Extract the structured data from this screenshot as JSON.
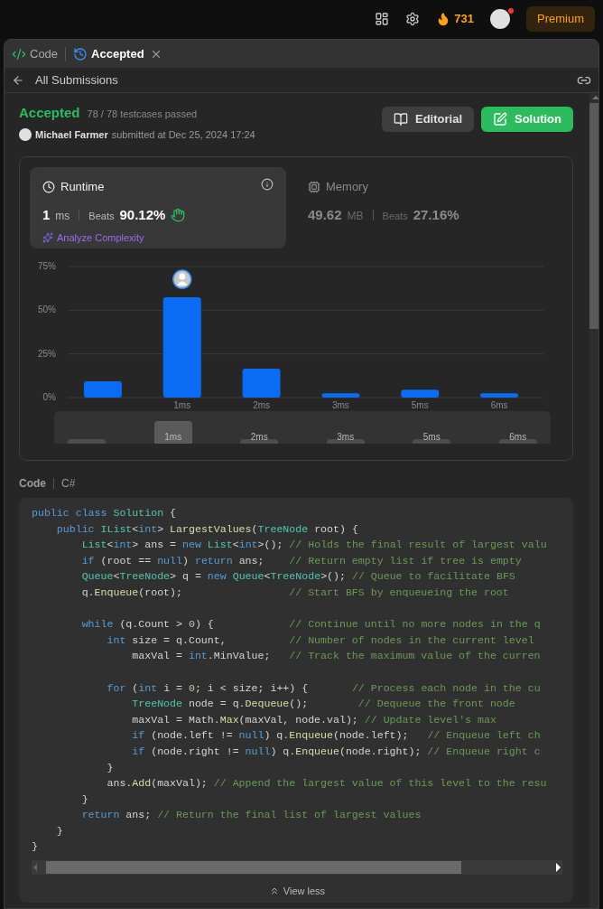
{
  "top_bar": {
    "streak": "731",
    "premium": "Premium",
    "notification_dot": true
  },
  "tabs": [
    {
      "label": "Code",
      "kind": "code",
      "selected": false,
      "closable": false
    },
    {
      "label": "Accepted",
      "kind": "history",
      "selected": true,
      "closable": true
    }
  ],
  "back_link": "All Submissions",
  "result": {
    "status": "Accepted",
    "testcases": "78 / 78 testcases passed",
    "author": "Michael Farmer",
    "submitted": "submitted at Dec 25, 2024 17:24"
  },
  "buttons": [
    {
      "label": "Editorial",
      "kind": "editorial"
    },
    {
      "label": "Solution",
      "kind": "solution"
    }
  ],
  "metrics": [
    {
      "kind": "runtime",
      "label": "Runtime",
      "value": "1",
      "unit": "ms",
      "beats_label": "Beats",
      "beats": "90.12%",
      "selected": true,
      "link": "Analyze Complexity"
    },
    {
      "kind": "memory",
      "label": "Memory",
      "value": "49.62",
      "unit": "MB",
      "beats_label": "Beats",
      "beats": "27.16%",
      "selected": false
    }
  ],
  "chart_data": {
    "type": "bar",
    "categories": [
      null,
      "1ms",
      "2ms",
      "3ms",
      "5ms",
      "6ms"
    ],
    "ylim": [
      0,
      75
    ],
    "yticks": [
      {
        "value": 0,
        "label": "0%"
      },
      {
        "value": 25,
        "label": "25%"
      },
      {
        "value": 50,
        "label": "50%"
      },
      {
        "value": 75,
        "label": "75%"
      }
    ],
    "series": [
      {
        "color": "#0a6cf5",
        "values": [
          9.3,
          57.4,
          16.5,
          2.5,
          4.5,
          2.5
        ]
      }
    ]
  },
  "overview": [
    {
      "selected": false
    },
    {
      "label": "1ms",
      "selected": true
    },
    {
      "label": "2ms",
      "selected": false
    },
    {
      "label": "3ms",
      "selected": false
    },
    {
      "label": "5ms",
      "selected": false
    },
    {
      "label": "6ms",
      "selected": false
    }
  ],
  "code_section": {
    "title": "Code",
    "language": "C#"
  },
  "code_lines": [
    {
      "kind": "code",
      "tokens": [
        {
          "kind": "k",
          "text": "public class "
        },
        {
          "kind": "t",
          "text": "Solution"
        },
        {
          "kind": "p",
          "text": " {"
        }
      ]
    },
    {
      "kind": "code",
      "tokens": [
        {
          "kind": "k",
          "text": "    public "
        },
        {
          "kind": "t",
          "text": "IList"
        },
        {
          "kind": "p",
          "text": "<"
        },
        {
          "kind": "k",
          "text": "int"
        },
        {
          "kind": "p",
          "text": "> "
        },
        {
          "kind": "f",
          "text": "LargestValues"
        },
        {
          "kind": "p",
          "text": "("
        },
        {
          "kind": "t",
          "text": "TreeNode"
        },
        {
          "kind": "p",
          "text": " root) {"
        }
      ]
    },
    {
      "kind": "code",
      "tokens": [
        {
          "kind": "t",
          "text": "        List"
        },
        {
          "kind": "p",
          "text": "<"
        },
        {
          "kind": "k",
          "text": "int"
        },
        {
          "kind": "p",
          "text": "> ans = "
        },
        {
          "kind": "k",
          "text": "new "
        },
        {
          "kind": "t",
          "text": "List"
        },
        {
          "kind": "p",
          "text": "<"
        },
        {
          "kind": "k",
          "text": "int"
        },
        {
          "kind": "p",
          "text": ">(); "
        },
        {
          "kind": "c",
          "text": "// Holds the final result of largest valu"
        }
      ]
    },
    {
      "kind": "code",
      "tokens": [
        {
          "kind": "k",
          "text": "        if"
        },
        {
          "kind": "p",
          "text": " (root == "
        },
        {
          "kind": "k",
          "text": "null"
        },
        {
          "kind": "p",
          "text": ") "
        },
        {
          "kind": "k",
          "text": "return"
        },
        {
          "kind": "p",
          "text": " ans;    "
        },
        {
          "kind": "c",
          "text": "// Return empty list if tree is empty"
        }
      ]
    },
    {
      "kind": "code",
      "tokens": [
        {
          "kind": "t",
          "text": "        Queue"
        },
        {
          "kind": "p",
          "text": "<"
        },
        {
          "kind": "t",
          "text": "TreeNode"
        },
        {
          "kind": "p",
          "text": "> q = "
        },
        {
          "kind": "k",
          "text": "new "
        },
        {
          "kind": "t",
          "text": "Queue"
        },
        {
          "kind": "p",
          "text": "<"
        },
        {
          "kind": "t",
          "text": "TreeNode"
        },
        {
          "kind": "p",
          "text": ">(); "
        },
        {
          "kind": "c",
          "text": "// Queue to facilitate BFS"
        }
      ]
    },
    {
      "kind": "code",
      "tokens": [
        {
          "kind": "p",
          "text": "        q."
        },
        {
          "kind": "f",
          "text": "Enqueue"
        },
        {
          "kind": "p",
          "text": "(root);                 "
        },
        {
          "kind": "c",
          "text": "// Start BFS by enqueueing the root"
        }
      ]
    },
    {
      "kind": "blank"
    },
    {
      "kind": "code",
      "tokens": [
        {
          "kind": "k",
          "text": "        while"
        },
        {
          "kind": "p",
          "text": " (q.Count > "
        },
        {
          "kind": "n",
          "text": "0"
        },
        {
          "kind": "p",
          "text": ") {            "
        },
        {
          "kind": "c",
          "text": "// Continue until no more nodes in the q"
        }
      ]
    },
    {
      "kind": "code",
      "tokens": [
        {
          "kind": "k",
          "text": "            int"
        },
        {
          "kind": "p",
          "text": " size = q.Count,          "
        },
        {
          "kind": "c",
          "text": "// Number of nodes in the current level"
        }
      ]
    },
    {
      "kind": "code",
      "tokens": [
        {
          "kind": "p",
          "text": "                maxVal = "
        },
        {
          "kind": "k",
          "text": "int"
        },
        {
          "kind": "p",
          "text": ".MinValue;   "
        },
        {
          "kind": "c",
          "text": "// Track the maximum value of the curren"
        }
      ]
    },
    {
      "kind": "blank"
    },
    {
      "kind": "code",
      "tokens": [
        {
          "kind": "k",
          "text": "            for"
        },
        {
          "kind": "p",
          "text": " ("
        },
        {
          "kind": "k",
          "text": "int"
        },
        {
          "kind": "p",
          "text": " i = "
        },
        {
          "kind": "n",
          "text": "0"
        },
        {
          "kind": "p",
          "text": "; i < size; i++) {       "
        },
        {
          "kind": "c",
          "text": "// Process each node in the cu"
        }
      ]
    },
    {
      "kind": "code",
      "tokens": [
        {
          "kind": "t",
          "text": "                TreeNode"
        },
        {
          "kind": "p",
          "text": " node = q."
        },
        {
          "kind": "f",
          "text": "Dequeue"
        },
        {
          "kind": "p",
          "text": "();        "
        },
        {
          "kind": "c",
          "text": "// Dequeue the front node"
        }
      ]
    },
    {
      "kind": "code",
      "tokens": [
        {
          "kind": "p",
          "text": "                maxVal = Math."
        },
        {
          "kind": "f",
          "text": "Max"
        },
        {
          "kind": "p",
          "text": "(maxVal, node.val); "
        },
        {
          "kind": "c",
          "text": "// Update level's max"
        }
      ]
    },
    {
      "kind": "code",
      "tokens": [
        {
          "kind": "k",
          "text": "                if"
        },
        {
          "kind": "p",
          "text": " (node.left != "
        },
        {
          "kind": "k",
          "text": "null"
        },
        {
          "kind": "p",
          "text": ") q."
        },
        {
          "kind": "f",
          "text": "Enqueue"
        },
        {
          "kind": "p",
          "text": "(node.left);   "
        },
        {
          "kind": "c",
          "text": "// Enqueue left ch"
        }
      ]
    },
    {
      "kind": "code",
      "tokens": [
        {
          "kind": "k",
          "text": "                if"
        },
        {
          "kind": "p",
          "text": " (node.right != "
        },
        {
          "kind": "k",
          "text": "null"
        },
        {
          "kind": "p",
          "text": ") q."
        },
        {
          "kind": "f",
          "text": "Enqueue"
        },
        {
          "kind": "p",
          "text": "(node.right); "
        },
        {
          "kind": "c",
          "text": "// Enqueue right c"
        }
      ]
    },
    {
      "kind": "code",
      "tokens": [
        {
          "kind": "p",
          "text": "            }"
        }
      ]
    },
    {
      "kind": "code",
      "tokens": [
        {
          "kind": "p",
          "text": "            ans."
        },
        {
          "kind": "f",
          "text": "Add"
        },
        {
          "kind": "p",
          "text": "(maxVal); "
        },
        {
          "kind": "c",
          "text": "// Append the largest value of this level to the resu"
        }
      ]
    },
    {
      "kind": "code",
      "tokens": [
        {
          "kind": "p",
          "text": "        }"
        }
      ]
    },
    {
      "kind": "code",
      "tokens": [
        {
          "kind": "k",
          "text": "        return"
        },
        {
          "kind": "p",
          "text": " ans; "
        },
        {
          "kind": "c",
          "text": "// Return the final list of largest values"
        }
      ]
    },
    {
      "kind": "code",
      "tokens": [
        {
          "kind": "p",
          "text": "    }"
        }
      ]
    },
    {
      "kind": "code",
      "tokens": [
        {
          "kind": "p",
          "text": "}"
        }
      ]
    }
  ],
  "view_less": "View less"
}
